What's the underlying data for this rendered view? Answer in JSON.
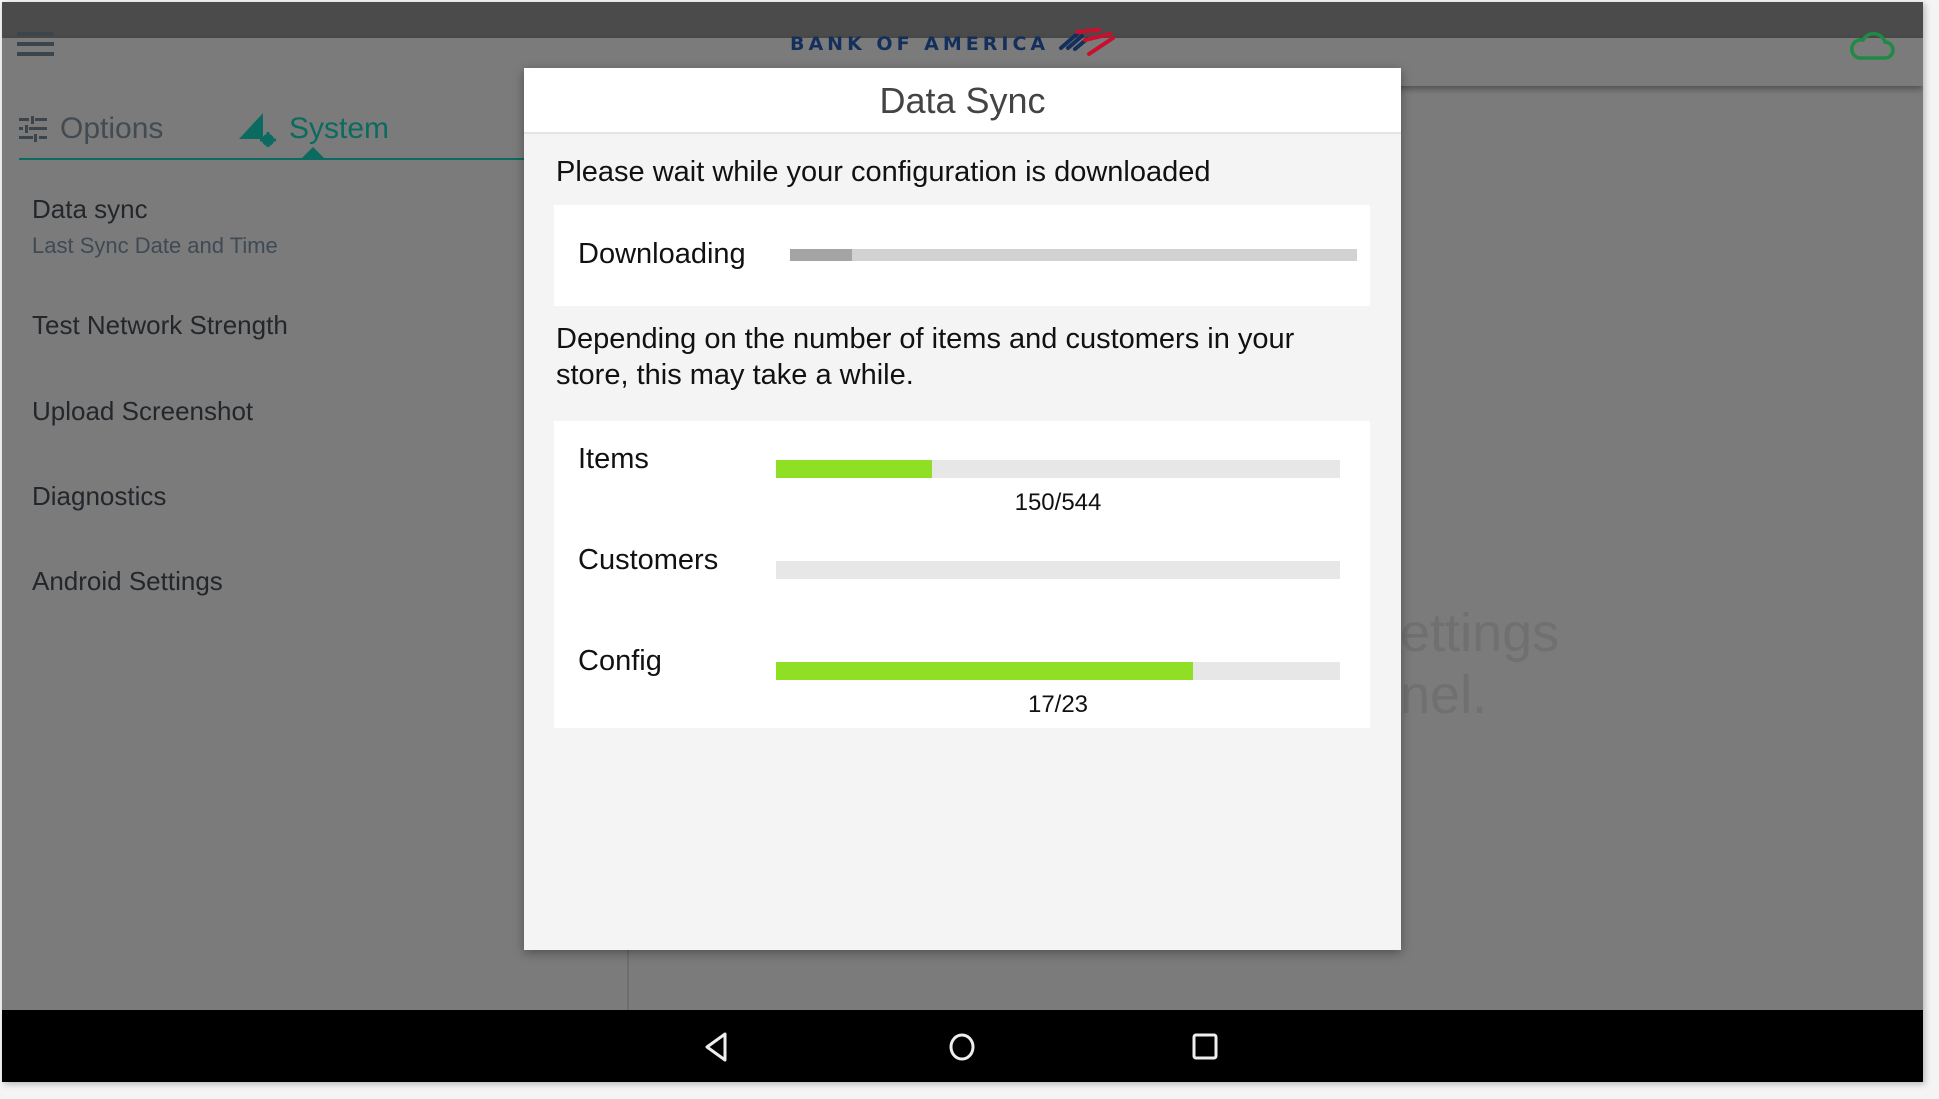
{
  "header": {
    "brand": "BANK OF AMERICA",
    "menu_icon": "hamburger-menu-icon",
    "sync_status_icon": "cloud-icon",
    "colors": {
      "brand_navy": "#142f5a",
      "brand_red": "#c8102e",
      "cloud_green": "#1e8a45"
    }
  },
  "tabs": [
    {
      "label": "Options",
      "icon": "sliders-icon",
      "active": false
    },
    {
      "label": "System",
      "icon": "system-settings-icon",
      "active": true
    }
  ],
  "settings_list": [
    {
      "label": "Data sync",
      "sublabel": "Last Sync Date and Time"
    },
    {
      "label": "Test Network Strength"
    },
    {
      "label": "Upload Screenshot"
    },
    {
      "label": "Diagnostics"
    },
    {
      "label": "Android Settings"
    }
  ],
  "background_hint": {
    "line1": "ettings",
    "line2": "nel."
  },
  "dialog": {
    "title": "Data Sync",
    "wait_message": "Please wait while your configuration is downloaded",
    "downloading_label": "Downloading",
    "downloading_state": "indeterminate",
    "info_message": "Depending on the number of items and customers in your store, this may take a while.",
    "progress": [
      {
        "label": "Items",
        "current": 150,
        "total": 544,
        "count_text": "150/544"
      },
      {
        "label": "Customers",
        "current": 0,
        "total": null,
        "count_text": ""
      },
      {
        "label": "Config",
        "current": 17,
        "total": 23,
        "count_text": "17/23"
      }
    ],
    "colors": {
      "progress_fill": "#8fe025",
      "progress_track": "#e7e7e7",
      "accent_teal": "#0b6b60"
    }
  },
  "nav_bar": {
    "back": "back-icon",
    "home": "home-icon",
    "recents": "recents-icon"
  }
}
